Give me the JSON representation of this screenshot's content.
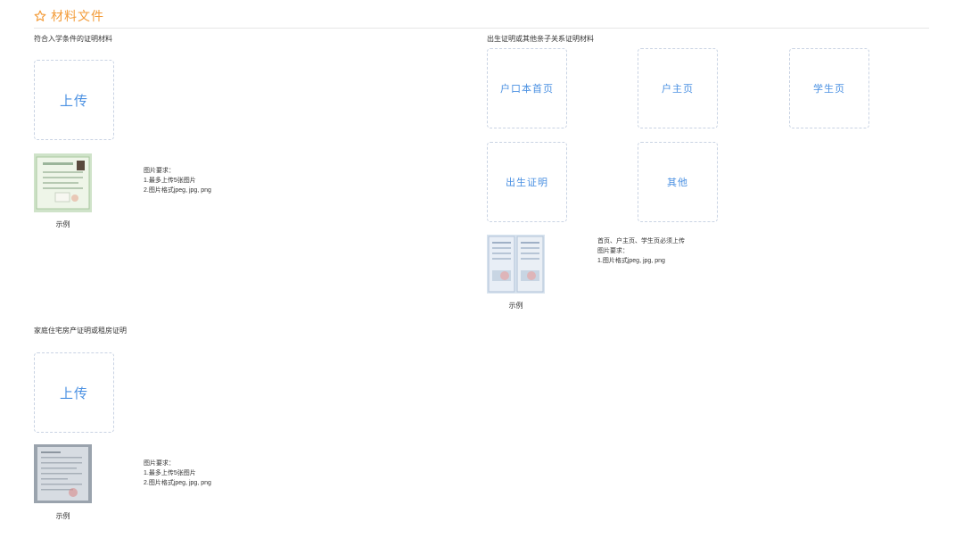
{
  "header": {
    "icon": "star-outline-icon",
    "title": "材料文件",
    "accent_color": "#f39c3a"
  },
  "sections": {
    "enrollment": {
      "label": "符合入学条件的证明材料",
      "upload_label": "上传",
      "example_label": "示例",
      "requirements": [
        "图片要求：",
        "1.最多上传5张图片",
        "2.图片格式jpeg, jpg, png"
      ]
    },
    "birth": {
      "label": "出生证明或其他亲子关系证明材料",
      "slots": [
        "户口本首页",
        "户主页",
        "学生页",
        "出生证明",
        "其他"
      ],
      "example_label": "示例",
      "requirements": [
        "首页、户主页、学生页必须上传",
        "图片要求：",
        "1.图片格式jpeg, jpg, png"
      ]
    },
    "housing": {
      "label": "家庭住宅房产证明或租房证明",
      "upload_label": "上传",
      "example_label": "示例",
      "requirements": [
        "图片要求：",
        "1.最多上传5张图片",
        "2.图片格式jpeg, jpg, png"
      ]
    }
  },
  "colors": {
    "upload_text": "#4a90e2",
    "dashed_border": "#c9d3e3"
  }
}
